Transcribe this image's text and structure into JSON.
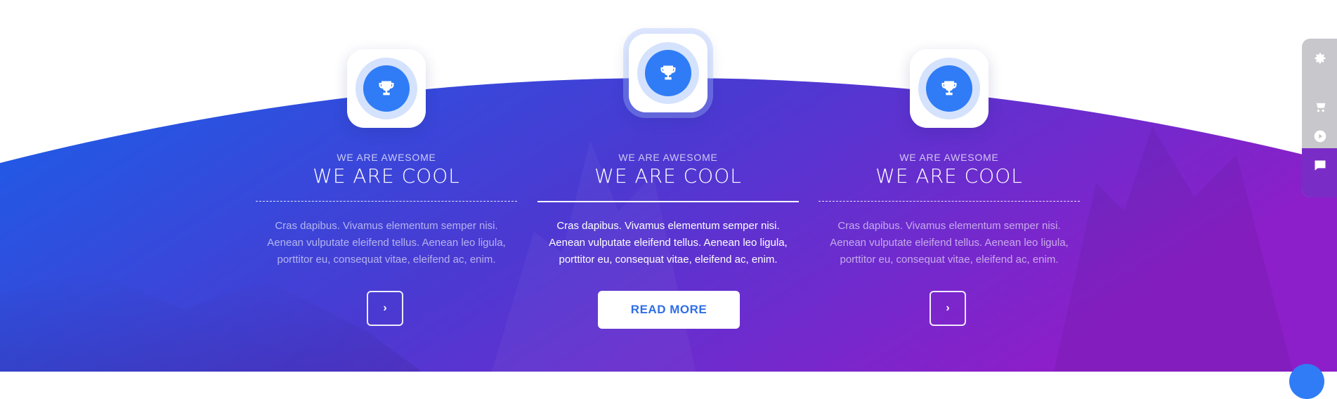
{
  "colors": {
    "gradient_start": "#1a5fe8",
    "gradient_mid": "#4a3ad2",
    "gradient_end": "#8c1fc9",
    "icon_circle": "#2f7cf6",
    "button_text": "#2f6ee6",
    "panel": "#c7c7cc",
    "panel_accent": "#7a2cc6"
  },
  "features": [
    {
      "icon": "trophy-icon",
      "subtitle": "WE ARE AWESOME",
      "title": "WE ARE COOL",
      "text": "Cras dapibus. Vivamus elementum semper nisi. Aenean vulputate eleifend tellus. Aenean leo ligula, porttitor eu, consequat vitae, eleifend ac, enim.",
      "button_label": "›"
    },
    {
      "icon": "trophy-icon",
      "subtitle": "WE ARE AWESOME",
      "title": "WE ARE COOL",
      "text": "Cras dapibus. Vivamus elementum semper nisi. Aenean vulputate eleifend tellus. Aenean leo ligula, porttitor eu, consequat vitae, eleifend ac, enim.",
      "button_label": "READ MORE"
    },
    {
      "icon": "trophy-icon",
      "subtitle": "WE ARE AWESOME",
      "title": "WE ARE COOL",
      "text": "Cras dapibus. Vivamus elementum semper nisi. Aenean vulputate eleifend tellus. Aenean leo ligula, porttitor eu, consequat vitae, eleifend ac, enim.",
      "button_label": "›"
    }
  ],
  "side_panel": {
    "icons": [
      "gear-icon",
      "cart-icon",
      "play-icon",
      "chat-icon"
    ]
  }
}
